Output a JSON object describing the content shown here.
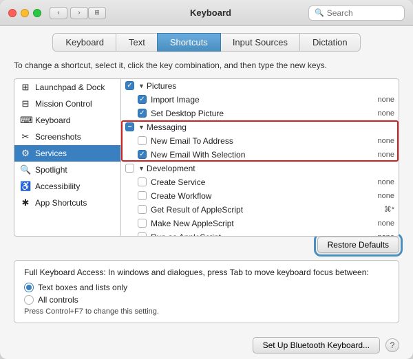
{
  "window": {
    "title": "Keyboard"
  },
  "search": {
    "placeholder": "Search"
  },
  "tabs": [
    {
      "id": "keyboard",
      "label": "Keyboard",
      "active": false
    },
    {
      "id": "text",
      "label": "Text",
      "active": false
    },
    {
      "id": "shortcuts",
      "label": "Shortcuts",
      "active": true
    },
    {
      "id": "input-sources",
      "label": "Input Sources",
      "active": false
    },
    {
      "id": "dictation",
      "label": "Dictation",
      "active": false
    }
  ],
  "hint": "To change a shortcut, select it, click the key combination, and then type the new keys.",
  "sidebar": {
    "items": [
      {
        "id": "launchpad",
        "icon": "⊞",
        "label": "Launchpad & Dock"
      },
      {
        "id": "mission-control",
        "icon": "⊟",
        "label": "Mission Control"
      },
      {
        "id": "keyboard",
        "icon": "⌨",
        "label": "Keyboard"
      },
      {
        "id": "screenshots",
        "icon": "✂",
        "label": "Screenshots"
      },
      {
        "id": "services",
        "icon": "⚙",
        "label": "Services",
        "selected": true
      },
      {
        "id": "spotlight",
        "icon": "🔍",
        "label": "Spotlight"
      },
      {
        "id": "accessibility",
        "icon": "♿",
        "label": "Accessibility"
      },
      {
        "id": "app-shortcuts",
        "icon": "✱",
        "label": "App Shortcuts"
      }
    ]
  },
  "shortcuts_groups": [
    {
      "id": "pictures",
      "label": "Pictures",
      "expanded": true,
      "items": [
        {
          "id": "import-image",
          "label": "Import Image",
          "key": "none",
          "checked": true
        },
        {
          "id": "set-desktop",
          "label": "Set Desktop Picture",
          "key": "none",
          "checked": true
        }
      ]
    },
    {
      "id": "messaging",
      "label": "Messaging",
      "expanded": true,
      "minus": true,
      "items": [
        {
          "id": "new-email",
          "label": "New Email To Address",
          "key": "none",
          "checked": false
        },
        {
          "id": "email-selection",
          "label": "New Email With Selection",
          "key": "none",
          "checked": true
        }
      ]
    },
    {
      "id": "development",
      "label": "Development",
      "expanded": true,
      "items": [
        {
          "id": "create-service",
          "label": "Create Service",
          "key": "none",
          "checked": false
        },
        {
          "id": "create-workflow",
          "label": "Create Workflow",
          "key": "none",
          "checked": false
        },
        {
          "id": "get-applescript",
          "label": "Get Result of AppleScript",
          "key": "⌘*",
          "checked": false
        },
        {
          "id": "make-applescript",
          "label": "Make New AppleScript",
          "key": "none",
          "checked": false
        },
        {
          "id": "run-applescript",
          "label": "Run as AppleScript",
          "key": "none",
          "checked": false
        }
      ]
    }
  ],
  "buttons": {
    "restore_defaults": "Restore Defaults",
    "bluetooth": "Set Up Bluetooth Keyboard...",
    "help": "?"
  },
  "keyboard_access": {
    "title": "Full Keyboard Access: In windows and dialogues, press Tab to move keyboard focus between:",
    "options": [
      {
        "id": "text-boxes",
        "label": "Text boxes and lists only",
        "selected": true
      },
      {
        "id": "all-controls",
        "label": "All controls",
        "selected": false
      }
    ],
    "hint": "Press Control+F7 to change this setting."
  }
}
